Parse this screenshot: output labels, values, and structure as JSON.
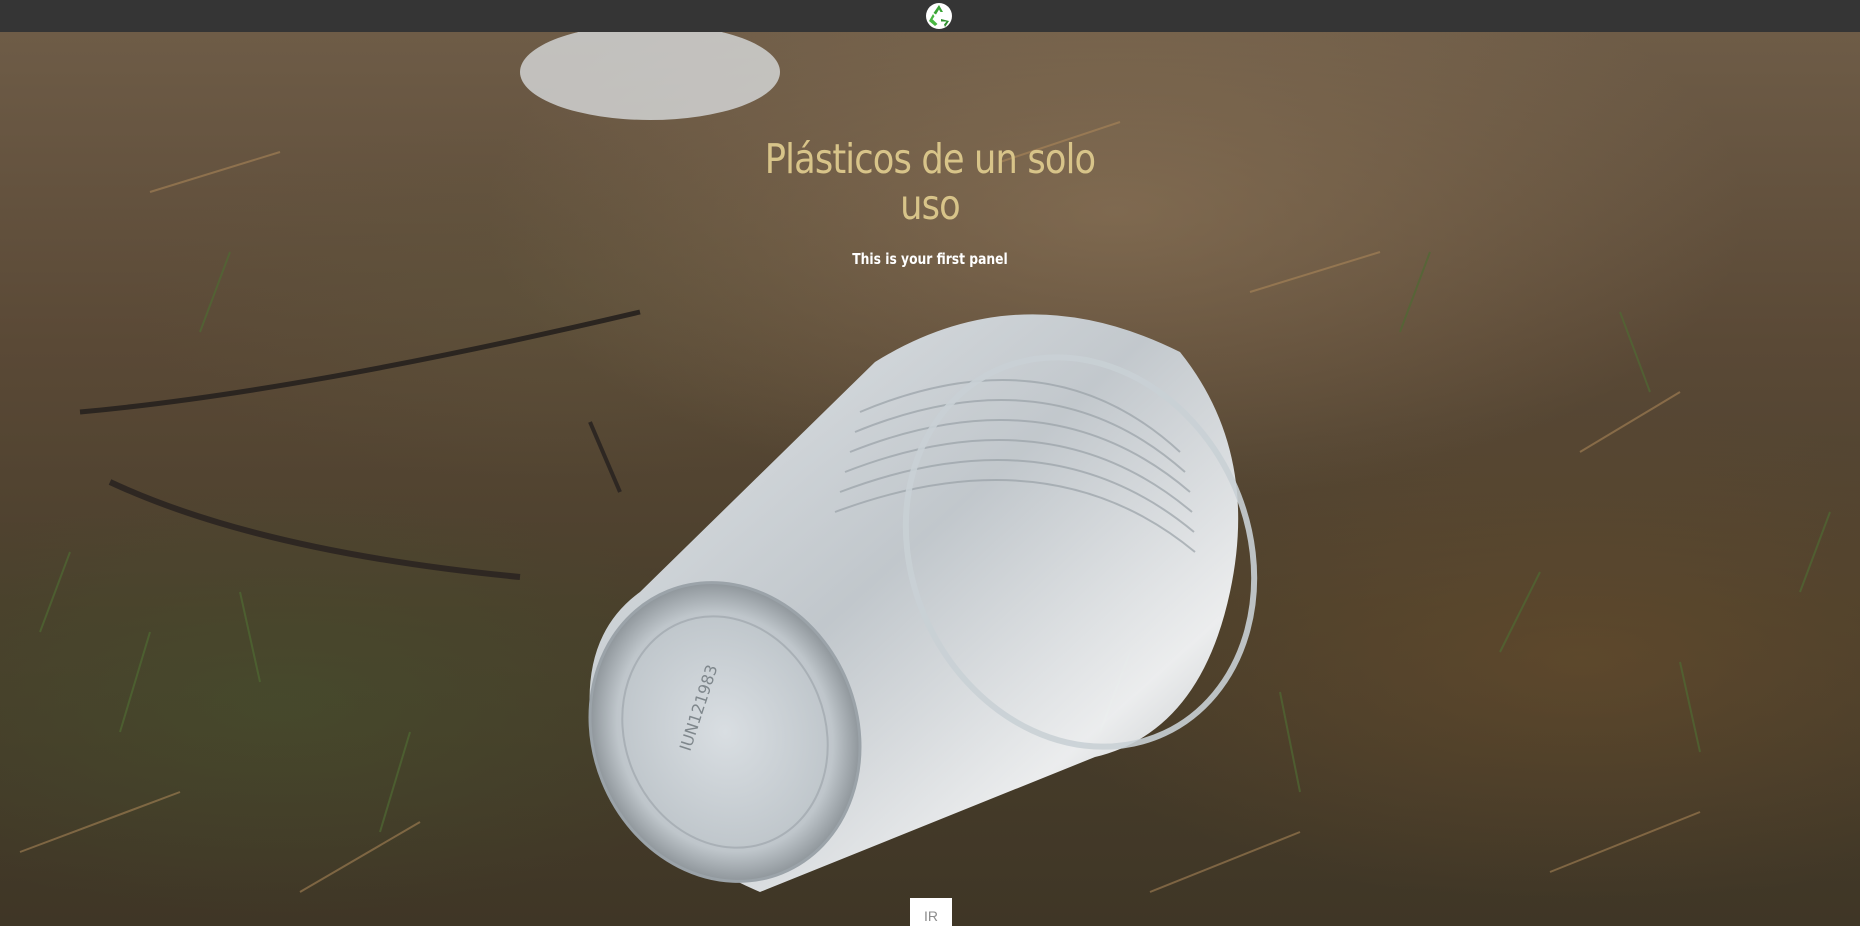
{
  "navbar": {
    "logo_icon": "recycle-icon"
  },
  "hero": {
    "title": "Plásticos de un solo uso",
    "subtitle": "This is your first panel",
    "button_label": "IR",
    "background_image": "plastic-cup-on-grass-photo"
  },
  "colors": {
    "navbar_bg": "#353535",
    "title": "#d8c489",
    "subtitle": "#ffffff",
    "button_bg": "#ffffff",
    "button_text": "#8c8c8c"
  }
}
